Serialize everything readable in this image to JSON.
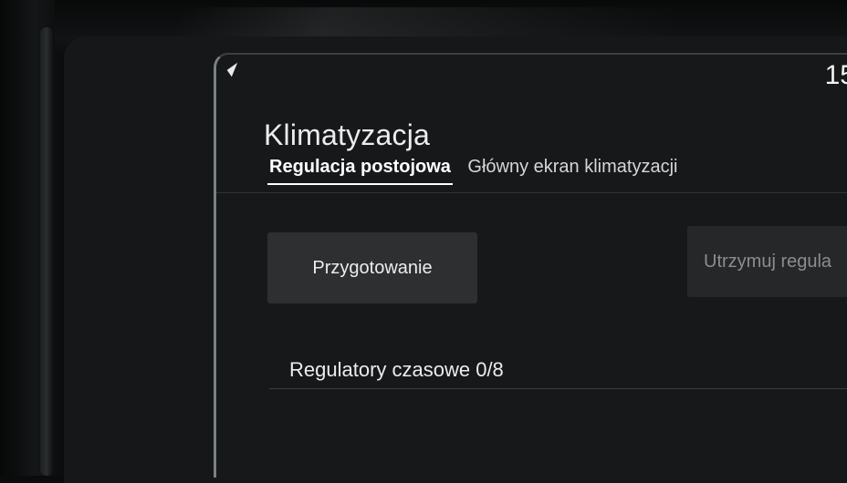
{
  "status": {
    "clock": "15"
  },
  "header": {
    "title": "Klimatyzacja"
  },
  "tabs": [
    {
      "label": "Regulacja postojowa",
      "active": true
    },
    {
      "label": "Główny ekran klimatyzacji",
      "active": false
    }
  ],
  "actions": {
    "prepare_label": "Przygotowanie",
    "maintain_label": "Utrzymuj regula"
  },
  "timers": {
    "label": "Regulatory czasowe 0/8"
  },
  "icons": {
    "nav": "navigation-arrow-icon"
  }
}
